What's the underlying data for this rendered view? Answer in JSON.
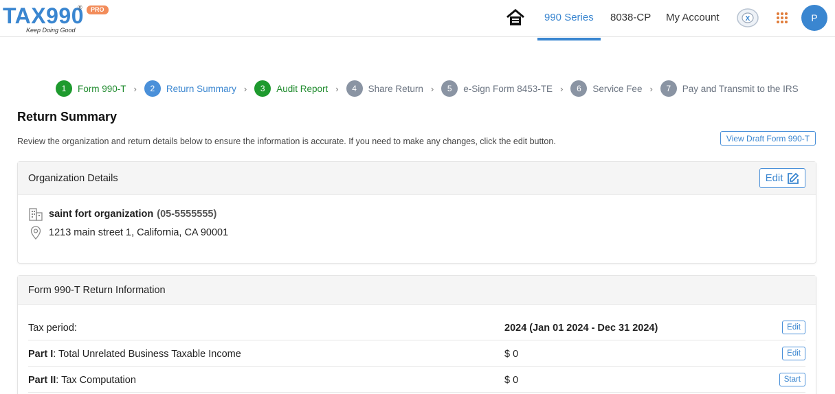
{
  "brand": {
    "logo_text": "TAX990",
    "registered": "®",
    "badge": "PRO",
    "tagline": "Keep Doing Good"
  },
  "nav": {
    "items": [
      {
        "label": "990 Series",
        "active": true
      },
      {
        "label": "8038-CP",
        "active": false
      },
      {
        "label": "My Account",
        "active": false
      }
    ],
    "avatar_initial": "P",
    "accent_color": "#3a86d0"
  },
  "stepper": {
    "steps": [
      {
        "num": "1",
        "label": "Form 990-T",
        "state": "done"
      },
      {
        "num": "2",
        "label": "Return Summary",
        "state": "current"
      },
      {
        "num": "3",
        "label": "Audit Report",
        "state": "done"
      },
      {
        "num": "4",
        "label": "Share Return",
        "state": "todo"
      },
      {
        "num": "5",
        "label": "e-Sign Form 8453-TE",
        "state": "todo"
      },
      {
        "num": "6",
        "label": "Service Fee",
        "state": "todo"
      },
      {
        "num": "7",
        "label": "Pay and Transmit to the IRS",
        "state": "todo"
      }
    ],
    "separator": "›"
  },
  "page": {
    "title": "Return Summary",
    "description": "Review the organization and return details below to ensure the information is accurate. If you need to make any changes, click the edit button.",
    "draft_button": "View Draft Form 990-T"
  },
  "org_card": {
    "title": "Organization Details",
    "edit_label": "Edit",
    "name": "saint fort organization",
    "ein": "(05-5555555)",
    "address": "1213 main street 1, California, CA 90001"
  },
  "return_card": {
    "title": "Form 990-T Return Information",
    "rows": [
      {
        "label_bold": "Tax period",
        "label_rest": ":",
        "value": "2024 (Jan 01 2024 - Dec 31 2024)",
        "button": "Edit"
      },
      {
        "label_bold": "Part I",
        "label_rest": ": Total Unrelated Business Taxable Income",
        "value": "$ 0",
        "button": "Edit"
      },
      {
        "label_bold": "Part II",
        "label_rest": ": Tax Computation",
        "value": "$ 0",
        "button": "Start"
      }
    ]
  }
}
